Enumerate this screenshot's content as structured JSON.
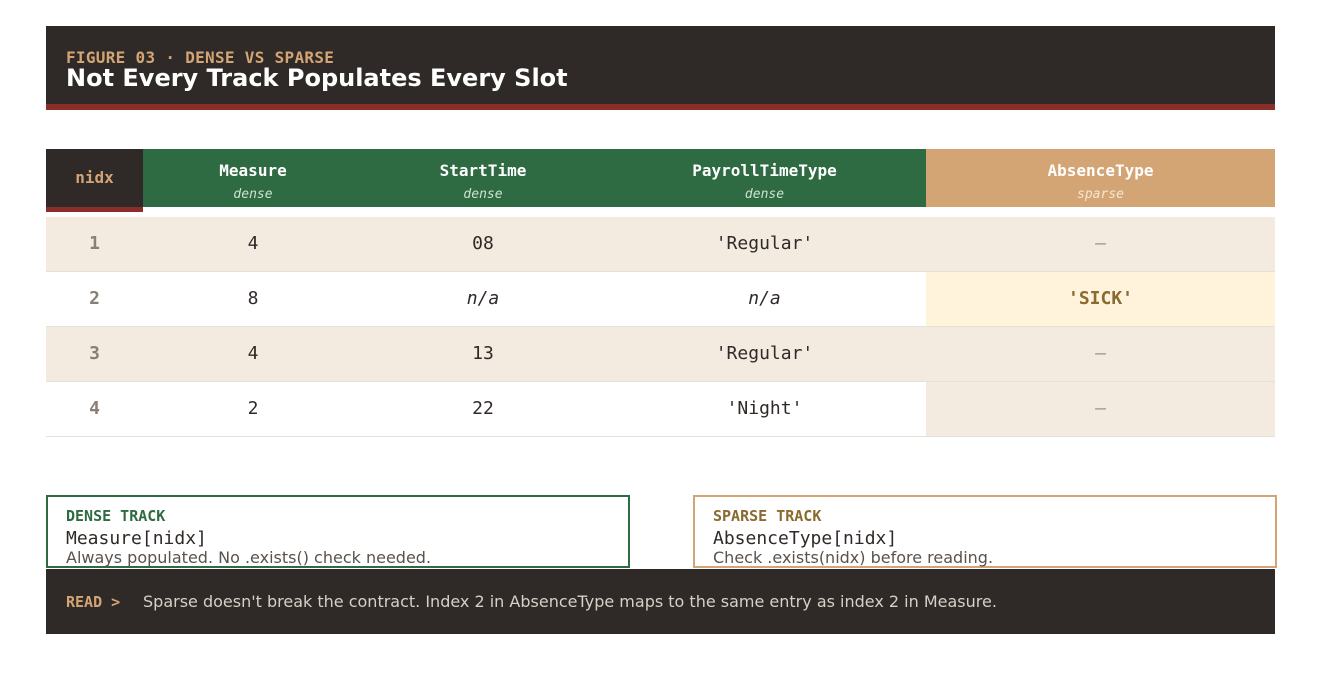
{
  "header": {
    "figure_label": "FIGURE 03 · DENSE VS SPARSE",
    "title": "Not Every Track Populates Every Slot"
  },
  "colors": {
    "dark": "#2f2a27",
    "accent_red": "#8b2e2a",
    "dense_green": "#2e6b42",
    "sparse_tan": "#d4a574",
    "row_tint": "#f3ebe0",
    "sparse_filled": "#fff3dc"
  },
  "table": {
    "index_header": "nidx",
    "columns": [
      {
        "name": "Measure",
        "kind": "dense"
      },
      {
        "name": "StartTime",
        "kind": "dense"
      },
      {
        "name": "PayrollTimeType",
        "kind": "dense"
      },
      {
        "name": "AbsenceType",
        "kind": "sparse"
      }
    ],
    "rows": [
      {
        "nidx": "1",
        "measure": "4",
        "start": "08",
        "payroll": "'Regular'",
        "absence": "—"
      },
      {
        "nidx": "2",
        "measure": "8",
        "start": "n/a",
        "payroll": "n/a",
        "absence": "'SICK'"
      },
      {
        "nidx": "3",
        "measure": "4",
        "start": "13",
        "payroll": "'Regular'",
        "absence": "—"
      },
      {
        "nidx": "4",
        "measure": "2",
        "start": "22",
        "payroll": "'Night'",
        "absence": "—"
      }
    ]
  },
  "dense_box": {
    "label": "DENSE TRACK",
    "code": "Measure[nidx]",
    "description": "Always populated. No .exists() check needed."
  },
  "sparse_box": {
    "label": "SPARSE TRACK",
    "code": "AbsenceType[nidx]",
    "description": "Check .exists(nidx) before reading."
  },
  "footer": {
    "label": "READ >",
    "text": "Sparse doesn't break the contract. Index 2 in AbsenceType maps to the same entry as index 2 in Measure."
  }
}
